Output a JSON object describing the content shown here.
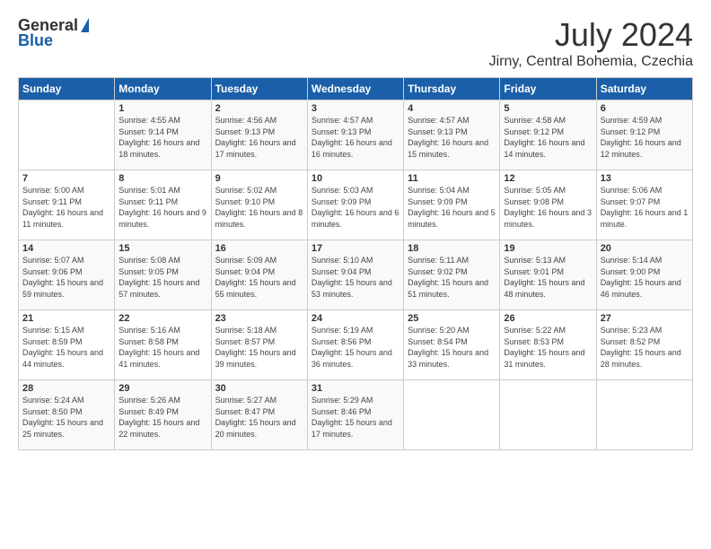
{
  "header": {
    "logo_general": "General",
    "logo_blue": "Blue",
    "month_year": "July 2024",
    "location": "Jirny, Central Bohemia, Czechia"
  },
  "days_of_week": [
    "Sunday",
    "Monday",
    "Tuesday",
    "Wednesday",
    "Thursday",
    "Friday",
    "Saturday"
  ],
  "weeks": [
    [
      {
        "num": "",
        "sunrise": "",
        "sunset": "",
        "daylight": ""
      },
      {
        "num": "1",
        "sunrise": "Sunrise: 4:55 AM",
        "sunset": "Sunset: 9:14 PM",
        "daylight": "Daylight: 16 hours and 18 minutes."
      },
      {
        "num": "2",
        "sunrise": "Sunrise: 4:56 AM",
        "sunset": "Sunset: 9:13 PM",
        "daylight": "Daylight: 16 hours and 17 minutes."
      },
      {
        "num": "3",
        "sunrise": "Sunrise: 4:57 AM",
        "sunset": "Sunset: 9:13 PM",
        "daylight": "Daylight: 16 hours and 16 minutes."
      },
      {
        "num": "4",
        "sunrise": "Sunrise: 4:57 AM",
        "sunset": "Sunset: 9:13 PM",
        "daylight": "Daylight: 16 hours and 15 minutes."
      },
      {
        "num": "5",
        "sunrise": "Sunrise: 4:58 AM",
        "sunset": "Sunset: 9:12 PM",
        "daylight": "Daylight: 16 hours and 14 minutes."
      },
      {
        "num": "6",
        "sunrise": "Sunrise: 4:59 AM",
        "sunset": "Sunset: 9:12 PM",
        "daylight": "Daylight: 16 hours and 12 minutes."
      }
    ],
    [
      {
        "num": "7",
        "sunrise": "Sunrise: 5:00 AM",
        "sunset": "Sunset: 9:11 PM",
        "daylight": "Daylight: 16 hours and 11 minutes."
      },
      {
        "num": "8",
        "sunrise": "Sunrise: 5:01 AM",
        "sunset": "Sunset: 9:11 PM",
        "daylight": "Daylight: 16 hours and 9 minutes."
      },
      {
        "num": "9",
        "sunrise": "Sunrise: 5:02 AM",
        "sunset": "Sunset: 9:10 PM",
        "daylight": "Daylight: 16 hours and 8 minutes."
      },
      {
        "num": "10",
        "sunrise": "Sunrise: 5:03 AM",
        "sunset": "Sunset: 9:09 PM",
        "daylight": "Daylight: 16 hours and 6 minutes."
      },
      {
        "num": "11",
        "sunrise": "Sunrise: 5:04 AM",
        "sunset": "Sunset: 9:09 PM",
        "daylight": "Daylight: 16 hours and 5 minutes."
      },
      {
        "num": "12",
        "sunrise": "Sunrise: 5:05 AM",
        "sunset": "Sunset: 9:08 PM",
        "daylight": "Daylight: 16 hours and 3 minutes."
      },
      {
        "num": "13",
        "sunrise": "Sunrise: 5:06 AM",
        "sunset": "Sunset: 9:07 PM",
        "daylight": "Daylight: 16 hours and 1 minute."
      }
    ],
    [
      {
        "num": "14",
        "sunrise": "Sunrise: 5:07 AM",
        "sunset": "Sunset: 9:06 PM",
        "daylight": "Daylight: 15 hours and 59 minutes."
      },
      {
        "num": "15",
        "sunrise": "Sunrise: 5:08 AM",
        "sunset": "Sunset: 9:05 PM",
        "daylight": "Daylight: 15 hours and 57 minutes."
      },
      {
        "num": "16",
        "sunrise": "Sunrise: 5:09 AM",
        "sunset": "Sunset: 9:04 PM",
        "daylight": "Daylight: 15 hours and 55 minutes."
      },
      {
        "num": "17",
        "sunrise": "Sunrise: 5:10 AM",
        "sunset": "Sunset: 9:04 PM",
        "daylight": "Daylight: 15 hours and 53 minutes."
      },
      {
        "num": "18",
        "sunrise": "Sunrise: 5:11 AM",
        "sunset": "Sunset: 9:02 PM",
        "daylight": "Daylight: 15 hours and 51 minutes."
      },
      {
        "num": "19",
        "sunrise": "Sunrise: 5:13 AM",
        "sunset": "Sunset: 9:01 PM",
        "daylight": "Daylight: 15 hours and 48 minutes."
      },
      {
        "num": "20",
        "sunrise": "Sunrise: 5:14 AM",
        "sunset": "Sunset: 9:00 PM",
        "daylight": "Daylight: 15 hours and 46 minutes."
      }
    ],
    [
      {
        "num": "21",
        "sunrise": "Sunrise: 5:15 AM",
        "sunset": "Sunset: 8:59 PM",
        "daylight": "Daylight: 15 hours and 44 minutes."
      },
      {
        "num": "22",
        "sunrise": "Sunrise: 5:16 AM",
        "sunset": "Sunset: 8:58 PM",
        "daylight": "Daylight: 15 hours and 41 minutes."
      },
      {
        "num": "23",
        "sunrise": "Sunrise: 5:18 AM",
        "sunset": "Sunset: 8:57 PM",
        "daylight": "Daylight: 15 hours and 39 minutes."
      },
      {
        "num": "24",
        "sunrise": "Sunrise: 5:19 AM",
        "sunset": "Sunset: 8:56 PM",
        "daylight": "Daylight: 15 hours and 36 minutes."
      },
      {
        "num": "25",
        "sunrise": "Sunrise: 5:20 AM",
        "sunset": "Sunset: 8:54 PM",
        "daylight": "Daylight: 15 hours and 33 minutes."
      },
      {
        "num": "26",
        "sunrise": "Sunrise: 5:22 AM",
        "sunset": "Sunset: 8:53 PM",
        "daylight": "Daylight: 15 hours and 31 minutes."
      },
      {
        "num": "27",
        "sunrise": "Sunrise: 5:23 AM",
        "sunset": "Sunset: 8:52 PM",
        "daylight": "Daylight: 15 hours and 28 minutes."
      }
    ],
    [
      {
        "num": "28",
        "sunrise": "Sunrise: 5:24 AM",
        "sunset": "Sunset: 8:50 PM",
        "daylight": "Daylight: 15 hours and 25 minutes."
      },
      {
        "num": "29",
        "sunrise": "Sunrise: 5:26 AM",
        "sunset": "Sunset: 8:49 PM",
        "daylight": "Daylight: 15 hours and 22 minutes."
      },
      {
        "num": "30",
        "sunrise": "Sunrise: 5:27 AM",
        "sunset": "Sunset: 8:47 PM",
        "daylight": "Daylight: 15 hours and 20 minutes."
      },
      {
        "num": "31",
        "sunrise": "Sunrise: 5:29 AM",
        "sunset": "Sunset: 8:46 PM",
        "daylight": "Daylight: 15 hours and 17 minutes."
      },
      {
        "num": "",
        "sunrise": "",
        "sunset": "",
        "daylight": ""
      },
      {
        "num": "",
        "sunrise": "",
        "sunset": "",
        "daylight": ""
      },
      {
        "num": "",
        "sunrise": "",
        "sunset": "",
        "daylight": ""
      }
    ]
  ]
}
